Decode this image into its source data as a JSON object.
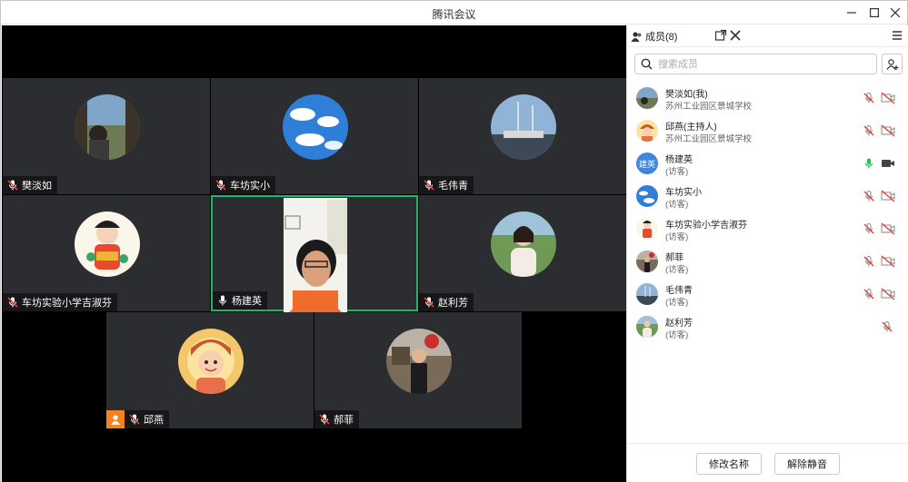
{
  "window": {
    "title": "腾讯会议"
  },
  "stage": {
    "tiles": [
      {
        "name": "樊淡如",
        "mic": "muted"
      },
      {
        "name": "车坊实小",
        "mic": "muted"
      },
      {
        "name": "毛伟青",
        "mic": "muted"
      },
      {
        "name": "车坊实验小学吉淑芬",
        "mic": "muted"
      },
      {
        "name": "杨建英",
        "mic": "on",
        "speaking": true
      },
      {
        "name": "赵利芳",
        "mic": "muted"
      },
      {
        "name": "邱燕",
        "mic": "muted",
        "host": true
      },
      {
        "name": "郝菲",
        "mic": "muted"
      }
    ]
  },
  "panel": {
    "tab_label": "成员(8)",
    "search_placeholder": "搜索成员",
    "members": [
      {
        "name": "樊淡如(我)",
        "sub": "苏州工业园区景城学校",
        "mic": "muted",
        "cam": "off"
      },
      {
        "name": "邱燕(主持人)",
        "sub": "苏州工业园区景城学校",
        "mic": "muted",
        "cam": "off"
      },
      {
        "name": "杨建英",
        "sub": "(访客)",
        "mic": "on",
        "cam": "on",
        "avatar_text": "建英"
      },
      {
        "name": "车坊实小",
        "sub": "(访客)",
        "mic": "muted",
        "cam": "off"
      },
      {
        "name": "车坊实验小学吉淑芬",
        "sub": "(访客)",
        "mic": "muted",
        "cam": "off"
      },
      {
        "name": "郝菲",
        "sub": "(访客)",
        "mic": "muted",
        "cam": "off"
      },
      {
        "name": "毛伟青",
        "sub": "(访客)",
        "mic": "muted",
        "cam": "off"
      },
      {
        "name": "赵利芳",
        "sub": "(访客)",
        "mic": "muted"
      }
    ],
    "rename_label": "修改名称",
    "unmute_label": "解除静音"
  },
  "colors": {
    "active_border": "#21b66b",
    "muted_red": "#e0433b",
    "mic_green": "#2bbf5a",
    "host_orange": "#f5811f",
    "stage_bg": "#000000",
    "tile_bg": "#2b2d31"
  }
}
